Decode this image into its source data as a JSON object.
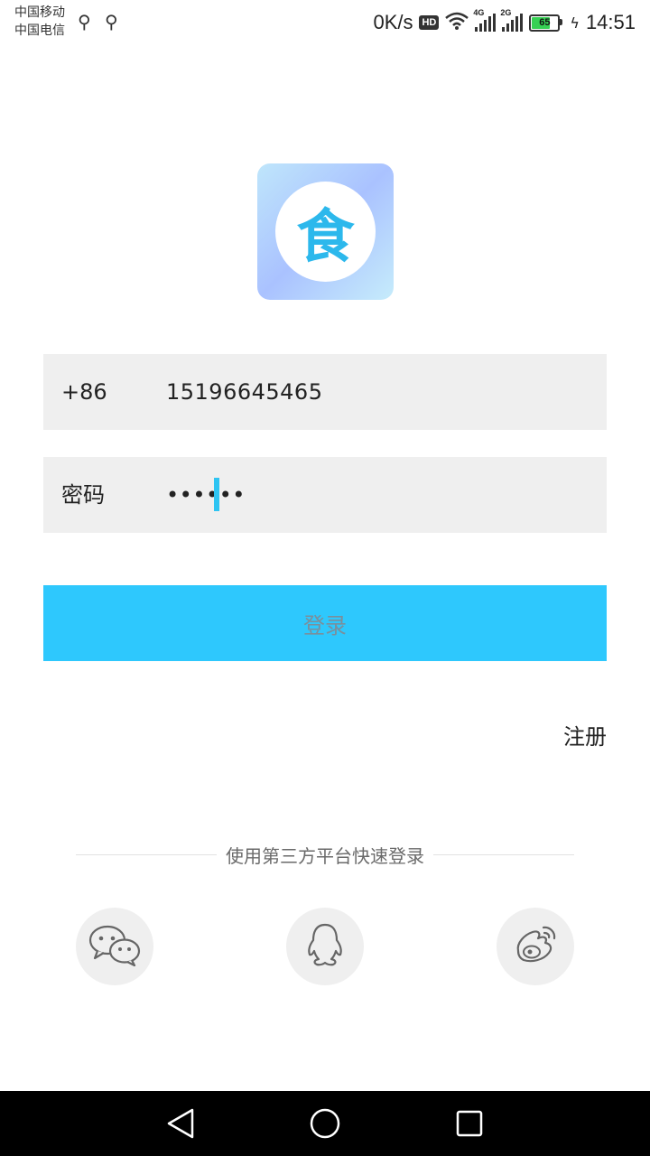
{
  "status_bar": {
    "carrier_1": "中国移动",
    "carrier_2": "中国电信",
    "net_speed": "0K/s",
    "hd_badge": "HD",
    "sim1_label": "4G",
    "sim2_label": "2G",
    "battery_level": "65",
    "time": "14:51"
  },
  "logo": {
    "glyph": "食"
  },
  "phone_field": {
    "prefix": "+86",
    "value": "15196645465"
  },
  "password_field": {
    "label": "密码",
    "value": "••••••"
  },
  "login_button": {
    "label": "登录"
  },
  "register_link": {
    "label": "注册"
  },
  "third_party": {
    "divider_text": "使用第三方平台快速登录",
    "providers": [
      "wechat-icon",
      "qq-icon",
      "weibo-icon"
    ]
  },
  "colors": {
    "accent": "#2ec8fd",
    "field_bg": "#efefef",
    "caret": "#2ec4f2"
  }
}
